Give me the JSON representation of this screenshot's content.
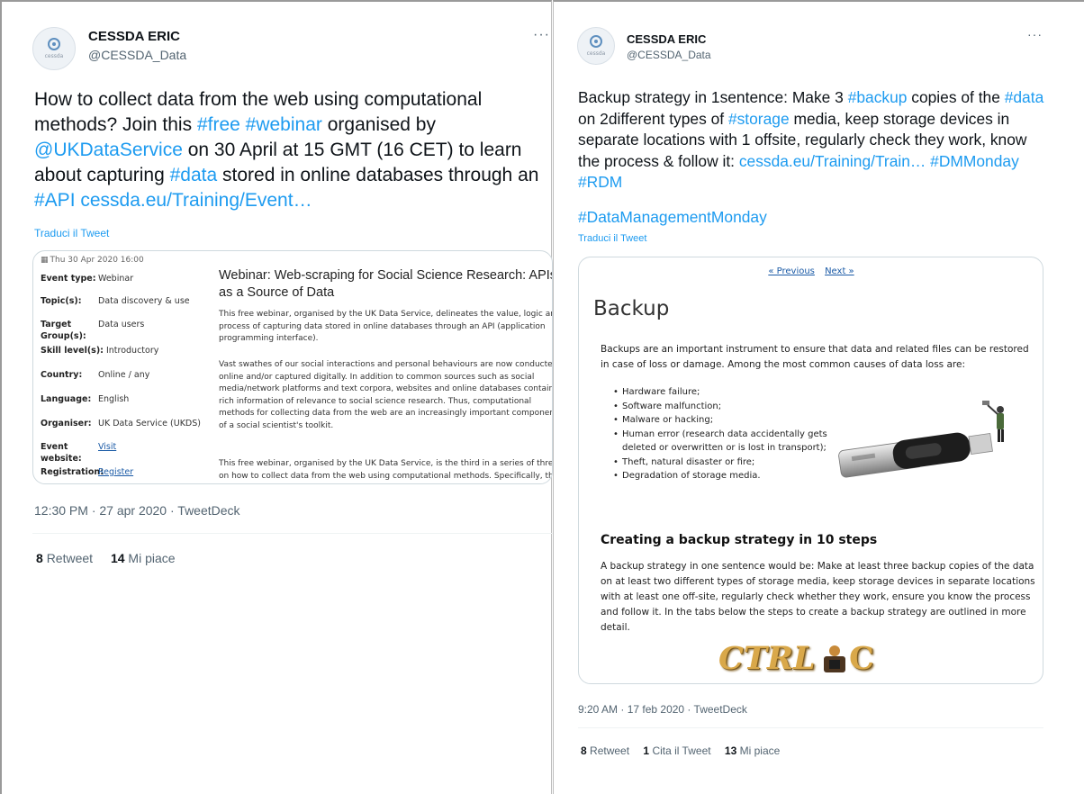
{
  "tweet_left": {
    "author_name": "CESSDA ERIC",
    "author_handle": "@CESSDA_Data",
    "avatar_text": "cessda",
    "more_label": "···",
    "text_parts": [
      {
        "t": "How to collect data from the web using computational methods? Join this ",
        "link": false
      },
      {
        "t": "#free",
        "link": true
      },
      {
        "t": " ",
        "link": false
      },
      {
        "t": "#webinar",
        "link": true
      },
      {
        "t": " organised by ",
        "link": false
      },
      {
        "t": "@UKDataService",
        "link": true
      },
      {
        "t": " on 30 April at 15 GMT (16 CET) to learn about capturing ",
        "link": false
      },
      {
        "t": "#data",
        "link": true
      },
      {
        "t": " stored in online databases through an ",
        "link": false
      },
      {
        "t": "#API",
        "link": true
      },
      {
        "t": " ",
        "link": false
      },
      {
        "t": "cessda.eu/Training/Event…",
        "link": true
      }
    ],
    "translate": "Traduci il Tweet",
    "card": {
      "date": "Thu 30 Apr 2020 16:00",
      "rows": [
        {
          "k": "Event type:",
          "v": "Webinar"
        },
        {
          "k": "Topic(s):",
          "v": "Data discovery & use"
        },
        {
          "k": "Target Group(s):",
          "v": "Data users"
        },
        {
          "k": "Skill level(s):",
          "v": "Introductory"
        },
        {
          "k": "Country:",
          "v": "Online / any"
        },
        {
          "k": "Language:",
          "v": "English"
        },
        {
          "k": "Organiser:",
          "v": "UK Data Service (UKDS)"
        },
        {
          "k": "Event website:",
          "v": "Visit"
        },
        {
          "k": "Registration:",
          "v": "Register"
        }
      ],
      "title": "Webinar: Web-scraping for Social Science Research: APIs as a Source of Data",
      "p1": "This free webinar, organised by the UK Data Service, delineates the value, logic and process of capturing data stored in online databases through an API (application programming interface).",
      "p2": "Vast swathes of our social interactions and personal behaviours are now conducted online and/or captured digitally. In addition to common sources such as social media/network platforms and text corpora, websites and online databases contain rich information of relevance to social science research. Thus, computational methods for collecting data from the web are an increasingly important component of a social scientist's toolkit.",
      "p3": "This free webinar, organised by the UK Data Service, is the third in a series of three on how to collect data from the web using computational methods. Specifically, this webinar"
    },
    "meta": "12:30 PM · 27 apr 2020 · TweetDeck",
    "retweets_count": "8",
    "retweets_label": "Retweet",
    "likes_count": "14",
    "likes_label": "Mi piace"
  },
  "tweet_right": {
    "author_name": "CESSDA ERIC",
    "author_handle": "@CESSDA_Data",
    "avatar_text": "cessda",
    "more_label": "···",
    "text_parts": [
      {
        "t": "Backup strategy in 1sentence: Make 3 ",
        "link": false
      },
      {
        "t": "#backup",
        "link": true
      },
      {
        "t": " copies of the ",
        "link": false
      },
      {
        "t": "#data",
        "link": true
      },
      {
        "t": " on 2different types of ",
        "link": false
      },
      {
        "t": "#storage",
        "link": true
      },
      {
        "t": " media, keep storage devices in separate locations with 1 offsite, regularly check they work, know the process & follow it: ",
        "link": false
      },
      {
        "t": "cessda.eu/Training/Train…",
        "link": true
      },
      {
        "t": " ",
        "link": false
      },
      {
        "t": "#DMMonday",
        "link": true
      },
      {
        "t": " ",
        "link": false
      },
      {
        "t": "#RDM",
        "link": true
      }
    ],
    "hashtag_line": "#DataManagementMonday",
    "translate": "Traduci il Tweet",
    "card": {
      "prev": "« Previous",
      "next": "Next »",
      "heading": "Backup",
      "intro": "Backups are an important instrument to ensure that data and related files can be restored in case of loss or damage. Among the most common causes of data loss are:",
      "causes": [
        "Hardware failure;",
        "Software malfunction;",
        "Malware or hacking;",
        "Human error (research data accidentally gets deleted or overwritten or is lost in transport);",
        "Theft, natural disaster or fire;",
        "Degradation of storage media."
      ],
      "subheading": "Creating a backup strategy in 10 steps",
      "body": "A backup strategy in one sentence would be: Make at least three backup copies of the data on at least two different types of storage media, keep storage devices in separate locations with at least one off-site, regularly check whether they work, ensure you know the process and follow it. In the tabs below the steps to create a backup strategy are outlined in more detail.",
      "ctrl_left": "CTRL",
      "ctrl_right": "C"
    },
    "meta": "9:20 AM · 17 feb 2020 · TweetDeck",
    "retweets_count": "8",
    "retweets_label": "Retweet",
    "quotes_count": "1",
    "quotes_label": "Cita il Tweet",
    "likes_count": "13",
    "likes_label": "Mi piace"
  },
  "colors": {
    "link": "#1d9bf0",
    "text": "#0f1419",
    "muted": "#536471"
  }
}
